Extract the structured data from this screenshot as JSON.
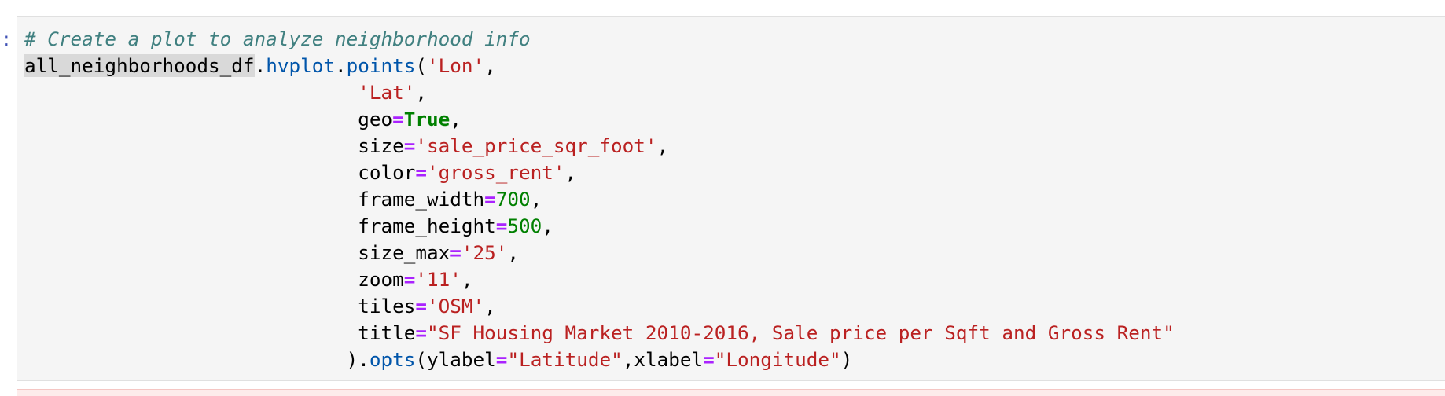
{
  "cell": {
    "prompt_marker": ":",
    "lines": {
      "l1": {
        "comment": "# Create a plot to analyze neighborhood info"
      },
      "l2": {
        "df": "all_neighborhoods_df",
        "dot1": ".",
        "hvplot": "hvplot",
        "dot2": ".",
        "points": "points",
        "open": "(",
        "arg": "'Lon'",
        "comma": ","
      },
      "l3": {
        "indent": "                             ",
        "arg": "'Lat'",
        "comma": ","
      },
      "l4": {
        "indent": "                             ",
        "key": "geo",
        "eq": "=",
        "val": "True",
        "comma": ","
      },
      "l5": {
        "indent": "                             ",
        "key": "size",
        "eq": "=",
        "val": "'sale_price_sqr_foot'",
        "comma": ","
      },
      "l6": {
        "indent": "                             ",
        "key": "color",
        "eq": "=",
        "val": "'gross_rent'",
        "comma": ","
      },
      "l7": {
        "indent": "                             ",
        "key": "frame_width",
        "eq": "=",
        "val": "700",
        "comma": ","
      },
      "l8": {
        "indent": "                             ",
        "key": "frame_height",
        "eq": "=",
        "val": "500",
        "comma": ","
      },
      "l9": {
        "indent": "                             ",
        "key": "size_max",
        "eq": "=",
        "val": "'25'",
        "comma": ","
      },
      "l10": {
        "indent": "                             ",
        "key": "zoom",
        "eq": "=",
        "val": "'11'",
        "comma": ","
      },
      "l11": {
        "indent": "                             ",
        "key": "tiles",
        "eq": "=",
        "val": "'OSM'",
        "comma": ","
      },
      "l12": {
        "indent": "                             ",
        "key": "title",
        "eq": "=",
        "val": "\"SF Housing Market 2010-2016, Sale price per Sqft and Gross Rent\""
      },
      "l13": {
        "indent": "                            ",
        "close": ").",
        "opts": "opts",
        "open": "(",
        "k1": "ylabel",
        "eq1": "=",
        "v1": "\"Latitude\"",
        "sep": ",",
        "k2": "xlabel",
        "eq2": "=",
        "v2": "\"Longitude\"",
        "end": ")"
      }
    }
  },
  "colors": {
    "comment": "#408080",
    "string": "#ba2121",
    "number": "#008000",
    "keyword": "#008000",
    "operator": "#aa22ff",
    "function": "#0055aa",
    "cell_background": "#f5f5f5",
    "error_background": "#fdeceb"
  }
}
